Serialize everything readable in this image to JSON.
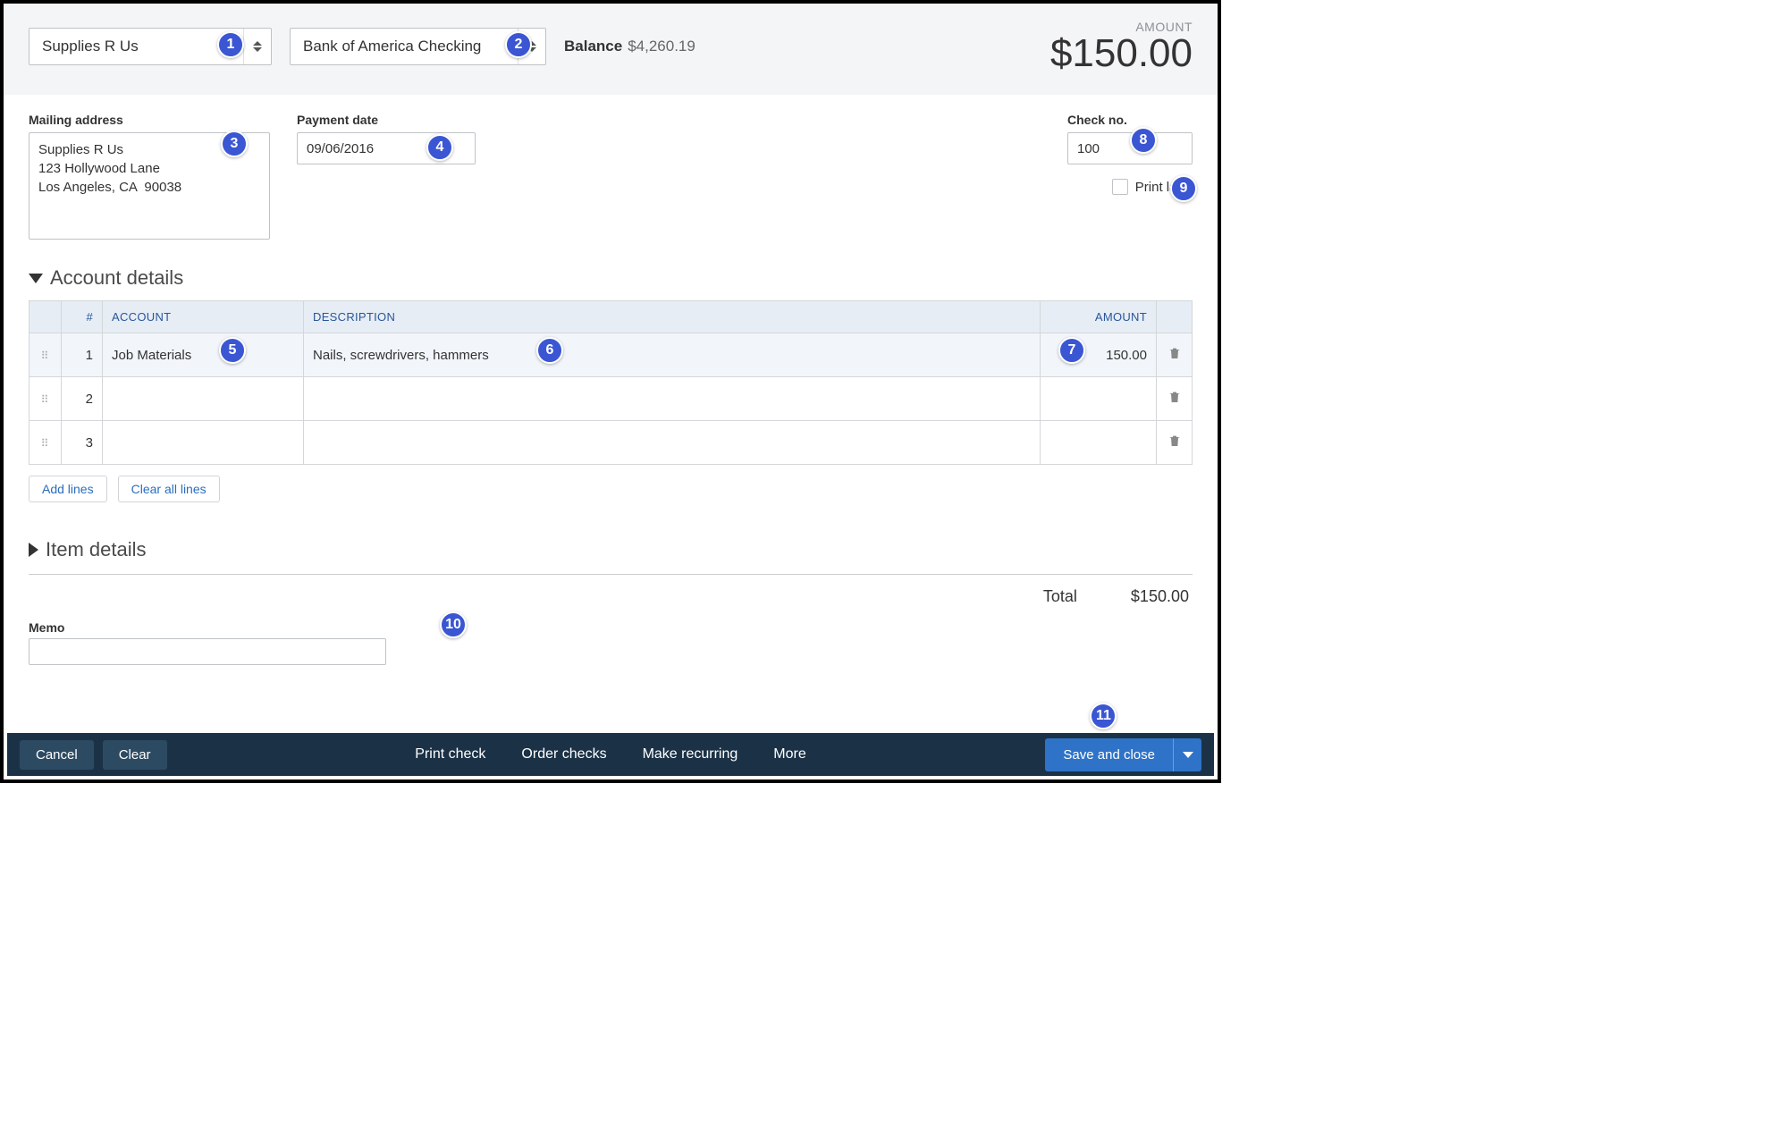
{
  "header": {
    "payee": "Supplies R Us",
    "account": "Bank of America Checking",
    "balance_label": "Balance",
    "balance_value": "$4,260.19",
    "amount_label": "AMOUNT",
    "amount_value": "$150.00"
  },
  "form": {
    "mailing_address_label": "Mailing address",
    "mailing_address_value": "Supplies R Us\n123 Hollywood Lane\nLos Angeles, CA  90038",
    "payment_date_label": "Payment date",
    "payment_date_value": "09/06/2016",
    "check_no_label": "Check no.",
    "check_no_value": "100",
    "print_later_label": "Print later"
  },
  "account_details": {
    "title": "Account details",
    "columns": {
      "num": "#",
      "account": "ACCOUNT",
      "description": "DESCRIPTION",
      "amount": "AMOUNT"
    },
    "rows": [
      {
        "num": "1",
        "account": "Job Materials",
        "description": "Nails, screwdrivers, hammers",
        "amount": "150.00"
      },
      {
        "num": "2",
        "account": "",
        "description": "",
        "amount": ""
      },
      {
        "num": "3",
        "account": "",
        "description": "",
        "amount": ""
      }
    ],
    "add_lines_label": "Add lines",
    "clear_all_label": "Clear all lines"
  },
  "item_details": {
    "title": "Item details"
  },
  "totals": {
    "label": "Total",
    "value": "$150.00"
  },
  "memo_label": "Memo",
  "bottom_bar": {
    "cancel": "Cancel",
    "clear": "Clear",
    "print_check": "Print check",
    "order_checks": "Order checks",
    "make_recurring": "Make recurring",
    "more": "More",
    "save_and_close": "Save and close"
  },
  "badges": [
    "1",
    "2",
    "3",
    "4",
    "5",
    "6",
    "7",
    "8",
    "9",
    "10",
    "11"
  ]
}
